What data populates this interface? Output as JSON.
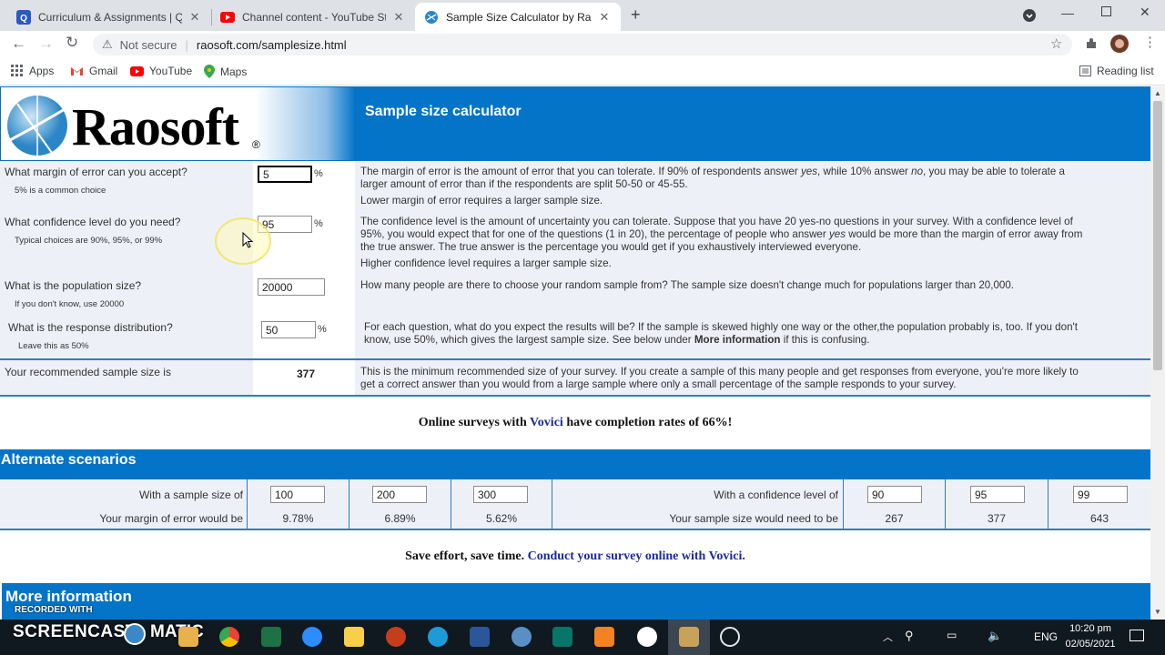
{
  "browser": {
    "tabs": [
      {
        "title": "Curriculum & Assignments | Qui",
        "icon": "quizizz-icon"
      },
      {
        "title": "Channel content - YouTube Stud",
        "icon": "youtube-icon"
      },
      {
        "title": "Sample Size Calculator by Raoso",
        "icon": "raosoft-icon"
      }
    ],
    "not_secure": "Not secure",
    "url": "raosoft.com/samplesize.html",
    "bookmarks": [
      "Apps",
      "Gmail",
      "YouTube",
      "Maps"
    ],
    "reading_list": "Reading list"
  },
  "page": {
    "logo": "Raosoft",
    "logo_mark": "®",
    "title": "Sample size calculator",
    "margin": {
      "question": "What margin of error can you accept?",
      "hint": "5% is a common choice",
      "value": "5",
      "unit": "%",
      "desc1a": "The margin of error is the amount of error that you can tolerate. If 90% of respondents answer ",
      "desc1_yes": "yes",
      "desc1b": ", while 10% answer ",
      "desc1_no": "no",
      "desc1c": ", you may be able to tolerate a",
      "desc1d": "larger amount of error than if the respondents are split 50-50 or 45-55.",
      "desc2": "Lower margin of error requires a larger sample size."
    },
    "confidence": {
      "question": "What confidence level do you need?",
      "hint": "Typical choices are 90%, 95%, or 99%",
      "value": "95",
      "unit": "%",
      "desc_l1": "The confidence level is the amount of uncertainty you can tolerate. Suppose that you have 20 yes-no questions in your survey. With a confidence level of",
      "desc_l2a": "95%, you would expect that for one of the questions (1 in 20), the percentage of people who answer ",
      "desc_l2_yes": "yes",
      "desc_l2b": " would be more than the margin of error away from",
      "desc_l3": "the true answer. The true answer is the percentage you would get if you exhaustively interviewed everyone.",
      "desc2": "Higher confidence level requires a larger sample size."
    },
    "population": {
      "question": "What is the population size?",
      "hint": "If you don't know, use 20000",
      "value": "20000",
      "desc": "How many people are there to choose your random sample from? The sample size doesn't change much for populations larger than 20,000."
    },
    "distribution": {
      "question": "What is the response distribution?",
      "hint": "Leave this as 50%",
      "value": "50",
      "unit": "%",
      "desc_l1": "For each question, what do you expect the results will be? If the sample is skewed highly one way or the other,the population probably is, too. If you don't",
      "desc_l2a": "know, use 50%, which gives the largest sample size. See below under ",
      "desc_l2_bold": "More information",
      "desc_l2b": " if this is confusing."
    },
    "result": {
      "label": "Your recommended sample size is",
      "value": "377",
      "desc_l1": "This is the minimum recommended size of your survey. If you create a sample of this many people and get responses from everyone, you're more likely to",
      "desc_l2": "get a correct answer than you would from a large sample where only a small percentage of the sample responds to your survey."
    },
    "promo1": {
      "a": "Online surveys with ",
      "link": "Vovici",
      "b": " have completion rates of 66%!"
    },
    "alternate": {
      "heading": "Alternate scenarios",
      "sample_label": "With a sample size of",
      "samples": [
        "100",
        "200",
        "300"
      ],
      "margin_label": "Your margin of error would be",
      "margins": [
        "9.78%",
        "6.89%",
        "5.62%"
      ],
      "conf_label": "With a confidence level of",
      "confs": [
        "90",
        "95",
        "99"
      ],
      "size_label": "Your sample size would need to be",
      "sizes": [
        "267",
        "377",
        "643"
      ]
    },
    "promo2": {
      "a": "Save effort, save time. ",
      "link": "Conduct your survey online with Vovici."
    },
    "more_info": "More information"
  },
  "watermark": {
    "line1": "RECORDED WITH",
    "line2": "SCREENCAST",
    "line3": "MATIC"
  },
  "taskbar": {
    "lang": "ENG",
    "time": "10:20 pm",
    "date": "02/05/2021"
  }
}
